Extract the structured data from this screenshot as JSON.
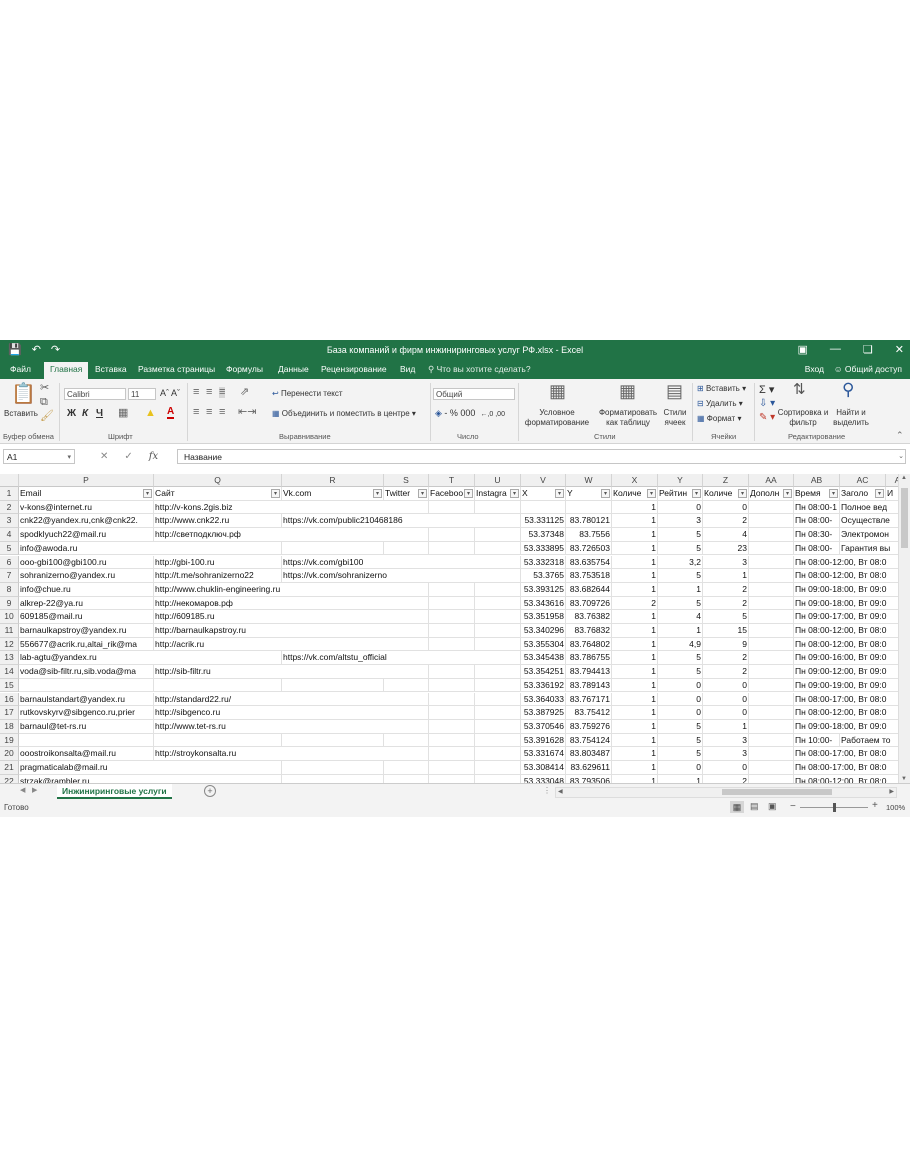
{
  "title_bar": {
    "title": "База компаний и фирм инжиниринговых услуг РФ.xlsx - Excel",
    "save_icon": "save-icon",
    "undo_icon": "undo-icon",
    "redo_icon": "redo-icon"
  },
  "tabs": [
    "Файл",
    "Главная",
    "Вставка",
    "Разметка страницы",
    "Формулы",
    "Данные",
    "Рецензирование",
    "Вид"
  ],
  "active_tab": "Главная",
  "tell_me": "Что вы хотите сделать?",
  "sign_in": "Вход",
  "share": "Общий доступ",
  "ribbon": {
    "clipboard": {
      "paste": "Вставить",
      "label": "Буфер обмена"
    },
    "font": {
      "name": "Calibri",
      "size": "11",
      "bold": "Ж",
      "italic": "К",
      "underline": "Ч",
      "label": "Шрифт"
    },
    "alignment": {
      "wrap": "Перенести текст",
      "merge": "Объединить и поместить в центре",
      "label": "Выравнивание"
    },
    "number": {
      "format": "Общий",
      "label": "Число"
    },
    "styles": {
      "conditional": "Условное форматирование",
      "as_table": "Форматировать как таблицу",
      "cell_styles": "Стили ячеек",
      "label": "Стили"
    },
    "cells": {
      "insert": "Вставить",
      "delete": "Удалить",
      "format": "Формат",
      "label": "Ячейки"
    },
    "editing": {
      "sort": "Сортировка и фильтр",
      "find": "Найти и выделить",
      "label": "Редактирование"
    }
  },
  "formula_bar": {
    "name_box": "A1",
    "formula": "Название"
  },
  "columns": [
    "P",
    "Q",
    "R",
    "S",
    "T",
    "U",
    "V",
    "W",
    "X",
    "Y",
    "Z",
    "AA",
    "AB",
    "AC",
    "AD"
  ],
  "headers": [
    "Email",
    "Сайт",
    "Vk.com",
    "Twitter",
    "Faceboo",
    "Instagra",
    "X",
    "Y",
    "Количе",
    "Рейтин",
    "Количе",
    "Дополн",
    "Время",
    "Заголо",
    "И"
  ],
  "rows": [
    {
      "n": "2",
      "c": [
        "v-kons@internet.ru",
        "http://v-kons.2gis.biz",
        "",
        "",
        "",
        "",
        "",
        "",
        "1",
        "0",
        "0",
        "",
        "Пн 08:00-1",
        "Полное вед",
        ""
      ]
    },
    {
      "n": "3",
      "c": [
        "cnk22@yandex.ru,cnk@cnk22.",
        "http://www.cnk22.ru",
        "https://vk.com/public210468186",
        "",
        "",
        "",
        "53.331125",
        "83.780121",
        "1",
        "3",
        "2",
        "",
        "Пн 08:00-",
        "Осуществле",
        ""
      ]
    },
    {
      "n": "4",
      "c": [
        "spodklyuch22@mail.ru",
        "http://светподключ.рф",
        "",
        "",
        "",
        "",
        "53.37348",
        "83.7556",
        "1",
        "5",
        "4",
        "",
        "Пн 08:30-",
        "Электромон",
        ""
      ]
    },
    {
      "n": "5",
      "c": [
        "info@awoda.ru",
        "",
        "",
        "",
        "",
        "",
        "53.333895",
        "83.726503",
        "1",
        "5",
        "23",
        "",
        "Пн 08:00-",
        "Гарантия вы",
        ""
      ]
    },
    {
      "n": "6",
      "c": [
        "ooo-gbi100@gbi100.ru",
        "http://gbi-100.ru",
        "https://vk.com/gbi100",
        "",
        "",
        "",
        "53.332318",
        "83.635754",
        "1",
        "3,2",
        "3",
        "",
        "Пн 08:00-12:00, Вт 08:0",
        "",
        ""
      ]
    },
    {
      "n": "7",
      "c": [
        "sohranizerno@yandex.ru",
        "http://t.me/sohranizerno22",
        "https://vk.com/sohranizerno",
        "",
        "",
        "",
        "53.3765",
        "83.753518",
        "1",
        "5",
        "1",
        "",
        "Пн 08:00-12:00, Вт 08:0",
        "",
        ""
      ]
    },
    {
      "n": "8",
      "c": [
        "info@chue.ru",
        "http://www.chuklin-engineering.ru",
        "",
        "",
        "",
        "",
        "53.393125",
        "83.682644",
        "1",
        "1",
        "2",
        "",
        "Пн 09:00-18:00, Вт 09:0",
        "",
        ""
      ]
    },
    {
      "n": "9",
      "c": [
        "alkrep-22@ya.ru",
        "http://некомаров.рф",
        "",
        "",
        "",
        "",
        "53.343616",
        "83.709726",
        "2",
        "5",
        "2",
        "",
        "Пн 09:00-18:00, Вт 09:0",
        "",
        ""
      ]
    },
    {
      "n": "10",
      "c": [
        "609185@mail.ru",
        "http://609185.ru",
        "",
        "",
        "",
        "",
        "53.351958",
        "83.76382",
        "1",
        "4",
        "5",
        "",
        "Пн 09:00-17:00, Вт 09:0",
        "",
        ""
      ]
    },
    {
      "n": "11",
      "c": [
        "barnaulkapstroy@yandex.ru",
        "http://barnaulkapstroy.ru",
        "",
        "",
        "",
        "",
        "53.340296",
        "83.76832",
        "1",
        "1",
        "15",
        "",
        "Пн 08:00-12:00, Вт 08:0",
        "",
        ""
      ]
    },
    {
      "n": "12",
      "c": [
        "556677@acrik.ru,altai_rik@ma",
        "http://acrik.ru",
        "",
        "",
        "",
        "",
        "53.355304",
        "83.764802",
        "1",
        "4,9",
        "9",
        "",
        "Пн 08:00-12:00, Вт 08:0",
        "",
        ""
      ]
    },
    {
      "n": "13",
      "c": [
        "lab-agtu@yandex.ru",
        "",
        "https://vk.com/altstu_official",
        "",
        "",
        "",
        "53.345438",
        "83.786755",
        "1",
        "5",
        "2",
        "",
        "Пн 09:00-16:00, Вт 09:0",
        "",
        ""
      ]
    },
    {
      "n": "14",
      "c": [
        "voda@sib-filtr.ru,sib.voda@ma",
        "http://sib-filtr.ru",
        "",
        "",
        "",
        "",
        "53.354251",
        "83.794413",
        "1",
        "5",
        "2",
        "",
        "Пн 09:00-12:00, Вт 09:0",
        "",
        ""
      ]
    },
    {
      "n": "15",
      "c": [
        "",
        "",
        "",
        "",
        "",
        "",
        "53.336192",
        "83.789143",
        "1",
        "0",
        "0",
        "",
        "Пн 09:00-19:00, Вт 09:0",
        "",
        ""
      ]
    },
    {
      "n": "16",
      "c": [
        "barnaulstandart@yandex.ru",
        "http://standard22.ru/",
        "",
        "",
        "",
        "",
        "53.364033",
        "83.767171",
        "1",
        "0",
        "0",
        "",
        "Пн 08:00-17:00, Вт 08:0",
        "",
        ""
      ]
    },
    {
      "n": "17",
      "c": [
        "rutkovskyrv@sibgenco.ru,prier",
        "http://sibgenco.ru",
        "",
        "",
        "",
        "",
        "53.387925",
        "83.75412",
        "1",
        "0",
        "0",
        "",
        "Пн 08:00-12:00, Вт 08:0",
        "",
        ""
      ]
    },
    {
      "n": "18",
      "c": [
        "barnaul@tet-rs.ru",
        "http://www.tet-rs.ru",
        "",
        "",
        "",
        "",
        "53.370546",
        "83.759276",
        "1",
        "5",
        "1",
        "",
        "Пн 09:00-18:00, Вт 09:0",
        "",
        ""
      ]
    },
    {
      "n": "19",
      "c": [
        "",
        "",
        "",
        "",
        "",
        "",
        "53.391628",
        "83.754124",
        "1",
        "5",
        "3",
        "",
        "Пн 10:00-",
        "Работаем то",
        ""
      ]
    },
    {
      "n": "20",
      "c": [
        "ooostroikonsalta@mail.ru",
        "http://stroykonsalta.ru",
        "",
        "",
        "",
        "",
        "53.331674",
        "83.803487",
        "1",
        "5",
        "3",
        "",
        "Пн 08:00-17:00, Вт 08:0",
        "",
        ""
      ]
    },
    {
      "n": "21",
      "c": [
        "pragmaticalab@mail.ru",
        "",
        "",
        "",
        "",
        "",
        "53.308414",
        "83.629611",
        "1",
        "0",
        "0",
        "",
        "Пн 08:00-17:00, Вт 08:0",
        "",
        ""
      ]
    },
    {
      "n": "22",
      "c": [
        "strzak@rambler.ru",
        "",
        "",
        "",
        "",
        "",
        "53.333048",
        "83.793506",
        "1",
        "1",
        "2",
        "",
        "Пн 08:00-12:00, Вт 08:0",
        "",
        ""
      ]
    }
  ],
  "sheet_tab": "Инжиниринговые услуги",
  "status": "Готово",
  "zoom": "100%",
  "accent_color": "#217346"
}
